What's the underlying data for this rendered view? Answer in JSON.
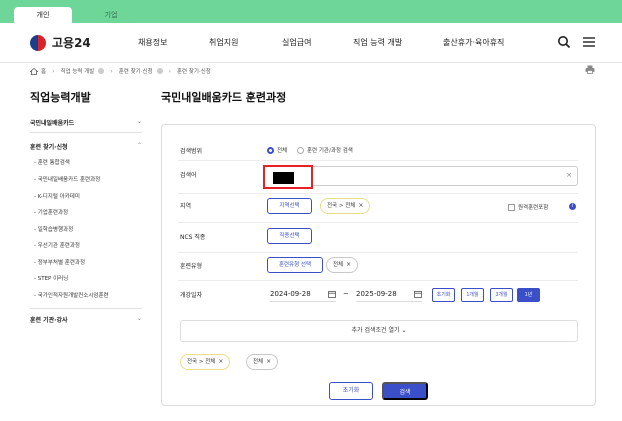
{
  "user_tabs": [
    "개인",
    "기업"
  ],
  "brand": {
    "name": "고용24"
  },
  "gnb": [
    "채용정보",
    "취업지원",
    "실업급여",
    "직업 능력 개발",
    "출산휴가·육아휴직"
  ],
  "breadcrumb": [
    "홈",
    "직업 능력 개발",
    "훈련 찾기·신청",
    "훈련 찾기·신청"
  ],
  "sidebar": {
    "title": "직업능력개발",
    "sections": [
      {
        "label": "국민내일배움카드"
      },
      {
        "label": "훈련 찾기·신청"
      },
      {
        "label": "훈련 기관·강사"
      }
    ],
    "items": [
      "- 훈련 통합검색",
      "- 국민내일배움카드 훈련과정",
      "- K-디지털 아카데미",
      "- 기업훈련과정",
      "- 일학습병행과정",
      "- 우선기관 훈련과정",
      "- 정부부처별 훈련과정",
      "- STEP 이러닝",
      "- 국가인적자원개발컨소시엄훈련"
    ]
  },
  "main": {
    "title": "국민내일배움카드 훈련과정",
    "labels": {
      "scope": "검색범위",
      "keyword": "검색어",
      "region": "지역",
      "ncs": "NCS 직종",
      "training_type": "훈련유형",
      "start_date": "개강일자"
    },
    "scope_options": [
      "전체",
      "훈련 기관/과정 검색"
    ],
    "keyword_clear": "×",
    "region_button": "지역선택",
    "region_chip": "전국 > 전체",
    "remote_checkbox": "원격훈련포함",
    "ncs_button": "직종선택",
    "type_button": "훈련유형 선택",
    "type_chip": "전체",
    "date_from": "2024-09-28",
    "date_to": "2025-09-28",
    "date_sep": "~",
    "periods": [
      "초기화",
      "1개월",
      "3개월",
      "1년"
    ],
    "more_conditions": "추가 검색조건 열기",
    "selected_chips": [
      "전국 > 전체",
      "전체"
    ],
    "reset_button": "초기화",
    "search_button": "검색"
  },
  "colors": {
    "top_bar": "#6fd69a",
    "accent": "#3a4fc8",
    "redaction_border": "#e8202a"
  }
}
